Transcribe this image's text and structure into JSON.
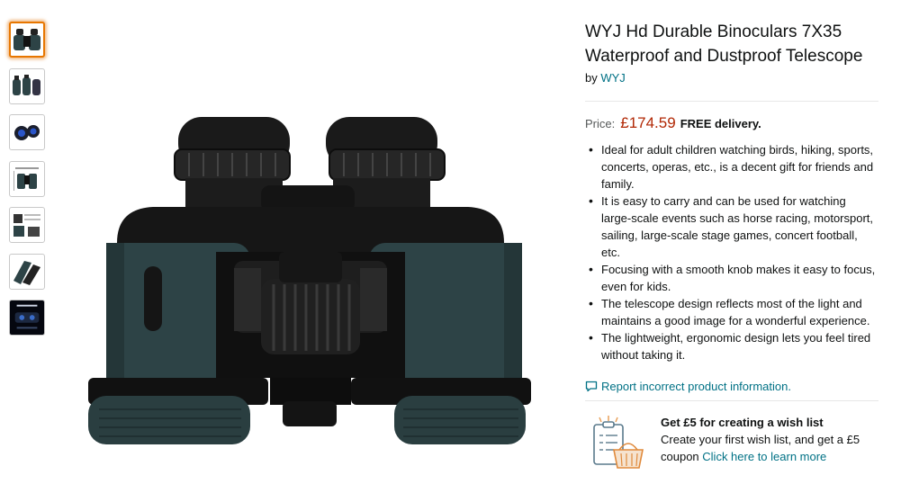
{
  "thumbnails": [
    {
      "name": "thumb-binoculars-front",
      "selected": true
    },
    {
      "name": "thumb-binoculars-angle",
      "selected": false
    },
    {
      "name": "thumb-binoculars-blue-lens",
      "selected": false
    },
    {
      "name": "thumb-binoculars-dimensions",
      "selected": false
    },
    {
      "name": "thumb-binoculars-features",
      "selected": false
    },
    {
      "name": "thumb-binoculars-hand",
      "selected": false
    },
    {
      "name": "thumb-binoculars-night",
      "selected": false
    }
  ],
  "product": {
    "title": "WYJ Hd Durable Binoculars 7X35 Waterproof and Dustproof Telescope",
    "by_prefix": "by",
    "brand": "WYJ",
    "price_label": "Price:",
    "price": "£174.59",
    "delivery": "FREE delivery.",
    "bullets": [
      "Ideal for adult children watching birds, hiking, sports, concerts, operas, etc., is a decent gift for friends and family.",
      "It is easy to carry and can be used for watching large-scale events such as horse racing, motorsport, sailing, large-scale stage games, concert football, etc.",
      "Focusing with a smooth knob makes it easy to focus, even for kids.",
      "The telescope design reflects most of the light and maintains a good image for a wonderful experience.",
      "The lightweight, ergonomic design lets you feel tired without taking it."
    ],
    "report_link": "Report incorrect product information."
  },
  "wishlist": {
    "title": "Get £5 for creating a wish list",
    "text": "Create your first wish list, and get a £5 coupon",
    "link": "Click here to learn more"
  },
  "colors": {
    "link": "#007185",
    "price": "#b12704",
    "selected_thumb_border": "#e77600",
    "binocular_body": "#2d4346"
  }
}
